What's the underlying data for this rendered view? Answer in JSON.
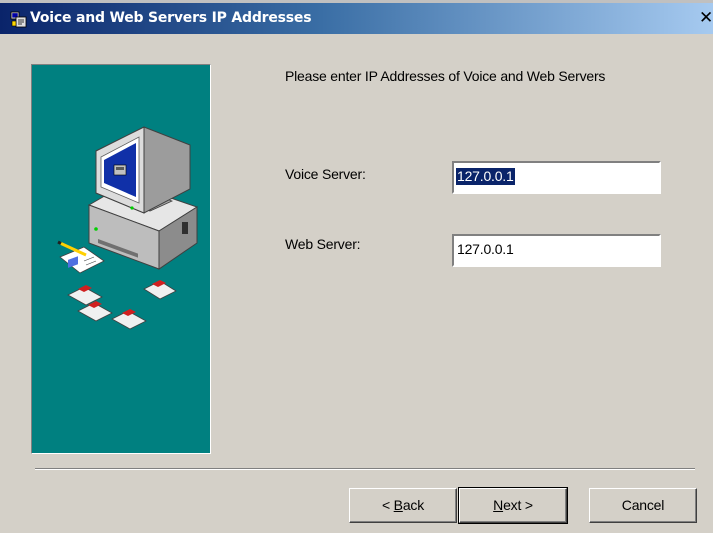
{
  "window": {
    "title": "Voice and Web Servers IP Addresses",
    "close_glyph": "✕"
  },
  "content": {
    "prompt": "Please enter IP Addresses of Voice and Web Servers",
    "voice": {
      "label": "Voice Server:",
      "value": "127.0.0.1",
      "selected": true
    },
    "web": {
      "label": "Web Server:",
      "value": "127.0.0.1"
    }
  },
  "buttons": {
    "back": {
      "label": "< Back",
      "mnemonic": "B"
    },
    "next": {
      "label": "Next >",
      "mnemonic": "N"
    },
    "cancel": {
      "label": "Cancel"
    }
  },
  "colors": {
    "title_active": "#0a246a",
    "panel_teal": "#008080",
    "dialog_face": "#d4d0c8",
    "selection": "#0a246a"
  },
  "icons": [
    "setup-app-icon",
    "computer-illustration",
    "document-pencil-illustration",
    "floppy-disk-illustration"
  ]
}
